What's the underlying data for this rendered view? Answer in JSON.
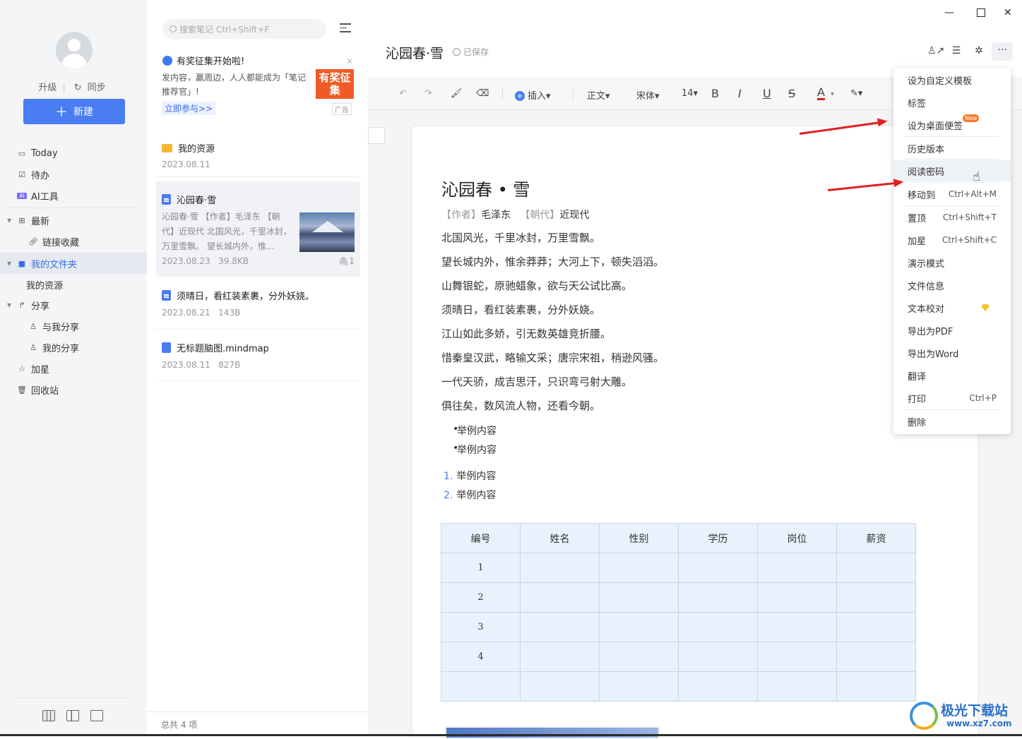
{
  "sidebar": {
    "upgrade": "升级",
    "sync": "同步",
    "new_button": "新建",
    "nav": [
      {
        "label": "Today",
        "icon": "calendar-icon"
      },
      {
        "label": "待办",
        "icon": "checkbox-icon"
      },
      {
        "label": "AI工具",
        "icon": "ai-icon"
      },
      {
        "label": "最新",
        "icon": "grid-icon"
      },
      {
        "label": "链接收藏",
        "icon": "link-icon"
      },
      {
        "label": "我的文件夹",
        "icon": "folder-icon"
      },
      {
        "label": "我的资源",
        "icon": ""
      },
      {
        "label": "分享",
        "icon": "share-icon"
      },
      {
        "label": "与我分享",
        "icon": "user-icon"
      },
      {
        "label": "我的分享",
        "icon": "user-icon"
      },
      {
        "label": "加星",
        "icon": "star-icon"
      },
      {
        "label": "回收站",
        "icon": "trash-icon"
      }
    ]
  },
  "list": {
    "search_placeholder": "搜索笔记 Ctrl+Shift+F",
    "promo": {
      "title": "有奖征集开始啦!",
      "text": "发内容，赢周边，人人都能成为「笔记推荐官」!",
      "link": "立即参与>>",
      "image_text": "有奖征集",
      "ad": "广告"
    },
    "notes": [
      {
        "title": "我的资源",
        "date": "2023.08.11",
        "size": ""
      },
      {
        "title": "沁园春·雪",
        "preview": "沁园春·雪 【作者】毛泽东 【朝代】近现代 北国风光，千里冰封，万里雪飘。 望长城内外，惟...",
        "date": "2023.08.23",
        "size": "39.8KB",
        "attach": "1"
      },
      {
        "title": "须晴日，看红装素裹，分外妖娆。",
        "date": "2023.08.21",
        "size": "143B"
      },
      {
        "title": "无标题脑图.mindmap",
        "date": "2023.08.11",
        "size": "827B"
      }
    ],
    "footer": "总共 4 项"
  },
  "editor": {
    "title": "沁园春·雪",
    "saved": "已保存",
    "toolbar": {
      "insert": "插入",
      "style": "正文",
      "font": "宋体",
      "size": "14",
      "bold": "B",
      "italic": "I",
      "underline": "U",
      "strike": "S",
      "fontcolor": "A"
    },
    "doc": {
      "heading": "沁园春 • 雪",
      "meta_author_label": "【作者】",
      "meta_author": "毛泽东",
      "meta_dynasty_label": "【朝代】",
      "meta_dynasty": "近现代",
      "lines": [
        "北国风光，千里冰封，万里雪飘。",
        "望长城内外，惟余莽莽；大河上下，顿失滔滔。",
        "山舞银蛇，原驰蜡象，欲与天公试比高。",
        "须晴日，看红装素裹，分外妖娆。",
        "江山如此多娇，引无数英雄竞折腰。",
        "惜秦皇汉武，略输文采；唐宗宋祖，稍逊风骚。",
        "一代天骄，成吉思汗，只识弯弓射大雕。",
        "俱往矣，数风流人物，还看今朝。"
      ],
      "bullets": [
        "举例内容",
        "举例内容"
      ],
      "ordered": [
        {
          "n": "1.",
          "t": "举例内容"
        },
        {
          "n": "2.",
          "t": "举例内容"
        }
      ],
      "table": {
        "headers": [
          "编号",
          "姓名",
          "性别",
          "学历",
          "岗位",
          "薪资"
        ],
        "rows": [
          [
            "1",
            "",
            "",
            "",
            "",
            ""
          ],
          [
            "2",
            "",
            "",
            "",
            "",
            ""
          ],
          [
            "3",
            "",
            "",
            "",
            "",
            ""
          ],
          [
            "4",
            "",
            "",
            "",
            "",
            ""
          ],
          [
            "",
            "",
            "",
            "",
            "",
            ""
          ]
        ]
      }
    }
  },
  "menu": {
    "items": [
      {
        "label": "设为自定义模板",
        "key": ""
      },
      {
        "label": "标签",
        "key": ""
      },
      {
        "label": "设为桌面便签",
        "key": "",
        "badge": "New"
      },
      {
        "label": "历史版本",
        "key": ""
      },
      {
        "label": "阅读密码",
        "key": ""
      },
      {
        "label": "移动到",
        "key": "Ctrl+Alt+M"
      },
      {
        "label": "置顶",
        "key": "Ctrl+Shift+T"
      },
      {
        "label": "加星",
        "key": "Ctrl+Shift+C"
      },
      {
        "label": "演示模式",
        "key": ""
      },
      {
        "label": "文件信息",
        "key": ""
      },
      {
        "label": "文本校对",
        "key": ""
      },
      {
        "label": "导出为PDF",
        "key": ""
      },
      {
        "label": "导出为Word",
        "key": ""
      },
      {
        "label": "翻译",
        "key": ""
      },
      {
        "label": "打印",
        "key": "Ctrl+P"
      },
      {
        "label": "删除",
        "key": ""
      }
    ]
  },
  "watermark": {
    "name": "极光下载站",
    "url": "www.xz7.com"
  },
  "colors": {
    "accent": "#4a7cf2",
    "arrow": "#e02020",
    "promo": "#ee5b23",
    "table_bg": "#e8f2fc"
  }
}
